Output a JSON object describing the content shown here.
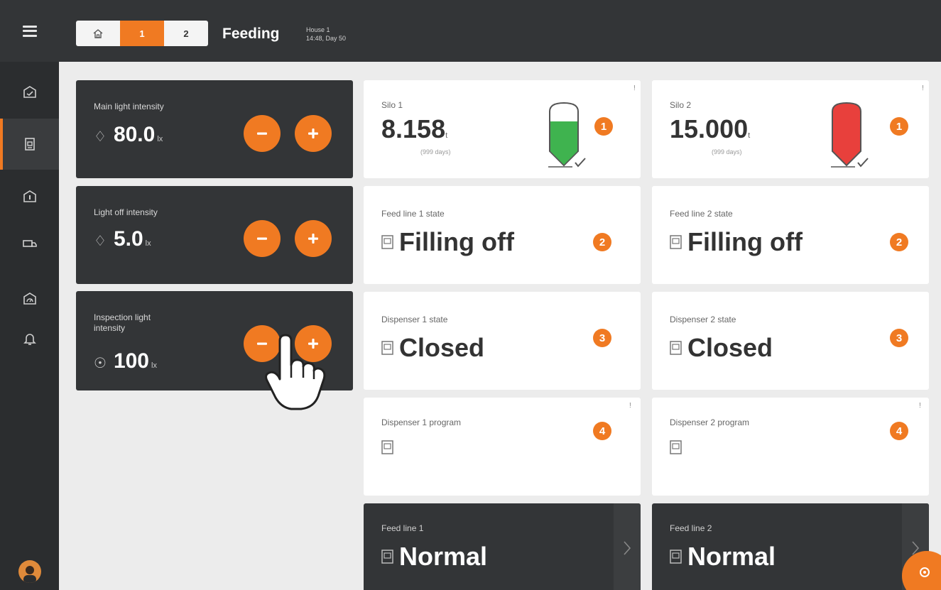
{
  "header": {
    "house_tabs": [
      {
        "label": "",
        "icon": "house-icon"
      },
      {
        "label": "1",
        "active": true
      },
      {
        "label": "2"
      }
    ],
    "title": "Feeding",
    "house_name": "House 1",
    "time_day": "14:48, Day 50"
  },
  "sidebar": {
    "items": [
      {
        "icon": "dashboard-icon"
      },
      {
        "icon": "feeding-icon",
        "active": true
      },
      {
        "icon": "climate-icon"
      },
      {
        "icon": "truck-icon"
      },
      {
        "icon": "gauge-icon"
      },
      {
        "icon": "bell-icon"
      }
    ],
    "avatar": "user-avatar"
  },
  "lights": [
    {
      "label": "Main light intensity",
      "value": "80.0",
      "unit": "lx"
    },
    {
      "label": "Light off intensity",
      "value": "5.0",
      "unit": "lx"
    },
    {
      "label": "Inspection light intensity",
      "value": "100",
      "unit": "lx"
    }
  ],
  "silos": [
    {
      "label": "Silo 1",
      "value": "8.158",
      "unit": "t",
      "days": "(999 days)",
      "badge": "1",
      "fill_color": "#3fb34f"
    },
    {
      "label": "Silo 2",
      "value": "15.000",
      "unit": "t",
      "days": "(999 days)",
      "badge": "1",
      "fill_color": "#e8403c"
    }
  ],
  "feed_line_states": [
    {
      "label": "Feed line 1 state",
      "value": "Filling off",
      "badge": "2"
    },
    {
      "label": "Feed line 2 state",
      "value": "Filling off",
      "badge": "2"
    }
  ],
  "dispenser_states": [
    {
      "label": "Dispenser 1 state",
      "value": "Closed",
      "badge": "3"
    },
    {
      "label": "Dispenser 2 state",
      "value": "Closed",
      "badge": "3"
    }
  ],
  "dispenser_programs": [
    {
      "label": "Dispenser 1 program",
      "badge": "4"
    },
    {
      "label": "Dispenser 2 program",
      "badge": "4"
    }
  ],
  "feed_lines": [
    {
      "label": "Feed line 1",
      "value": "Normal"
    },
    {
      "label": "Feed line 2",
      "value": "Normal"
    }
  ],
  "colors": {
    "accent": "#f07a22",
    "dark": "#333537",
    "sidebar": "#2b2d2f"
  }
}
